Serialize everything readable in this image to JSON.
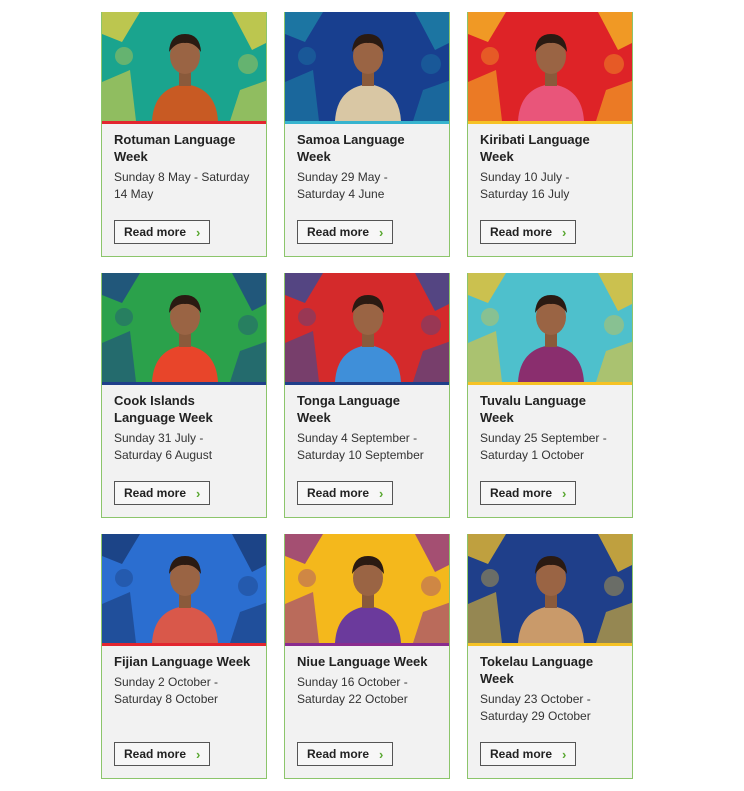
{
  "read_more_label": "Read more",
  "chevron": "›",
  "cards": [
    {
      "title": "Rotuman Language Week",
      "dates": "Sunday 8 May - Saturday 14 May",
      "bg": "#1aa48e",
      "accent": "#e3262f",
      "pattern": "#f3d23a",
      "shirt": "#c85a23",
      "icon": "person-photo"
    },
    {
      "title": "Samoa Language Week",
      "dates": "Sunday 29 May - Saturday 4 June",
      "bg": "#183f8f",
      "accent": "#37b4cf",
      "pattern": "#1d88a8",
      "shirt": "#d9c7a4",
      "icon": "person-photo"
    },
    {
      "title": "Kiribati Language Week",
      "dates": "Sunday 10 July - Saturday 16 July",
      "bg": "#de2327",
      "accent": "#f6c225",
      "pattern": "#f6c225",
      "shirt": "#e9557a",
      "icon": "person-photo"
    },
    {
      "title": "Cook Islands Language Week",
      "dates": "Sunday 31 July - Saturday 6 August",
      "bg": "#2ba14b",
      "accent": "#1f3f8a",
      "pattern": "#1f3f8a",
      "shirt": "#e8452a",
      "icon": "person-photo"
    },
    {
      "title": "Tonga Language Week",
      "dates": "Sunday 4 September - Saturday 10 September",
      "bg": "#d42a2b",
      "accent": "#1f3f8a",
      "pattern": "#2a4fa0",
      "shirt": "#3f8fd9",
      "icon": "person-photo"
    },
    {
      "title": "Tuvalu Language Week",
      "dates": "Sunday 25 September - Saturday 1 October",
      "bg": "#4ec0cc",
      "accent": "#f6c225",
      "pattern": "#f6c225",
      "shirt": "#8a2e6e",
      "icon": "person-photo"
    },
    {
      "title": "Fijian Language Week",
      "dates": "Sunday 2 October - Saturday 8 October",
      "bg": "#2b6ed0",
      "accent": "#e3262f",
      "pattern": "#18376f",
      "shirt": "#d9584a",
      "icon": "person-photo"
    },
    {
      "title": "Niue Language Week",
      "dates": "Sunday 16 October - Saturday 22 October",
      "bg": "#f4b81c",
      "accent": "#8a2c8f",
      "pattern": "#8a2c8f",
      "shirt": "#6b3a9c",
      "icon": "person-photo"
    },
    {
      "title": "Tokelau Language Week",
      "dates": "Sunday 23 October - Saturday 29 October",
      "bg": "#1f3f8a",
      "accent": "#f6c225",
      "pattern": "#f6c225",
      "shirt": "#c99a6a",
      "icon": "person-photo"
    }
  ]
}
